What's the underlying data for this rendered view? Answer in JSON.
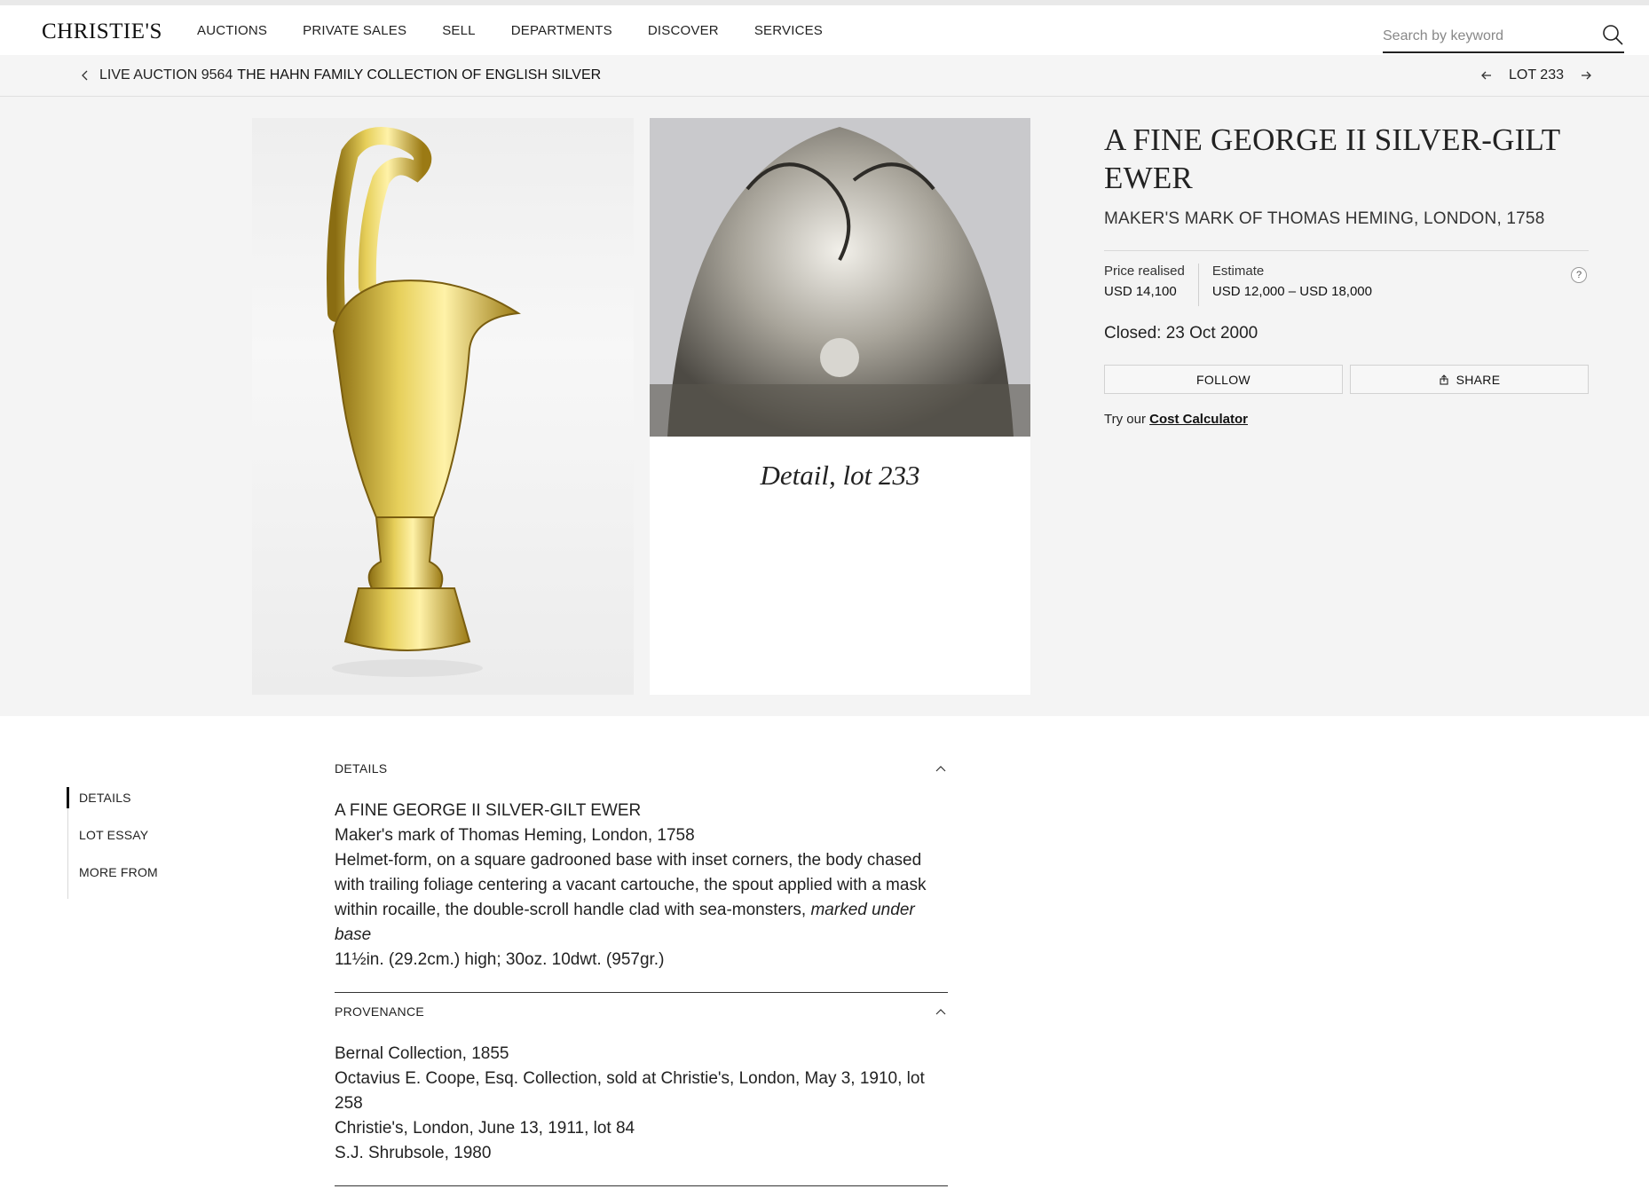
{
  "header": {
    "logo": "CHRISTIE'S",
    "nav": [
      "AUCTIONS",
      "PRIVATE SALES",
      "SELL",
      "DEPARTMENTS",
      "DISCOVER",
      "SERVICES"
    ],
    "search_placeholder": "Search by keyword"
  },
  "breadcrumb": {
    "prefix": "LIVE AUCTION 9564",
    "title": "THE HAHN FAMILY COLLECTION OF ENGLISH SILVER",
    "lot_label": "LOT 233"
  },
  "images": {
    "detail_caption": "Detail, lot 233"
  },
  "lot": {
    "title": "A FINE GEORGE II SILVER-GILT EWER",
    "subtitle": "MAKER'S MARK OF THOMAS HEMING, LONDON, 1758",
    "price_label": "Price realised",
    "price_value": "USD 14,100",
    "estimate_label": "Estimate",
    "estimate_value": "USD 12,000 – USD 18,000",
    "help": "?",
    "closed": "Closed: 23 Oct 2000",
    "follow": "FOLLOW",
    "share": "SHARE",
    "cost_prefix": "Try our",
    "cost_link": "Cost Calculator"
  },
  "side_nav": [
    "DETAILS",
    "LOT ESSAY",
    "MORE FROM"
  ],
  "details": {
    "heading": "DETAILS",
    "line1": "A FINE GEORGE II SILVER-GILT EWER",
    "line2": "Maker's mark of Thomas Heming, London, 1758",
    "line3": "Helmet-form, on a square gadrooned base with inset corners, the body chased with trailing foliage centering a vacant cartouche, the spout applied with a mask within rocaille, the double-scroll handle clad with sea-monsters,",
    "line3_em": "marked under base",
    "line4": "11½in. (29.2cm.) high; 30oz. 10dwt. (957gr.)"
  },
  "provenance": {
    "heading": "PROVENANCE",
    "lines": [
      "Bernal Collection, 1855",
      "Octavius E. Coope, Esq. Collection, sold at Christie's, London, May 3, 1910, lot 258",
      "Christie's, London, June 13, 1911, lot 84",
      "S.J. Shrubsole, 1980"
    ]
  }
}
